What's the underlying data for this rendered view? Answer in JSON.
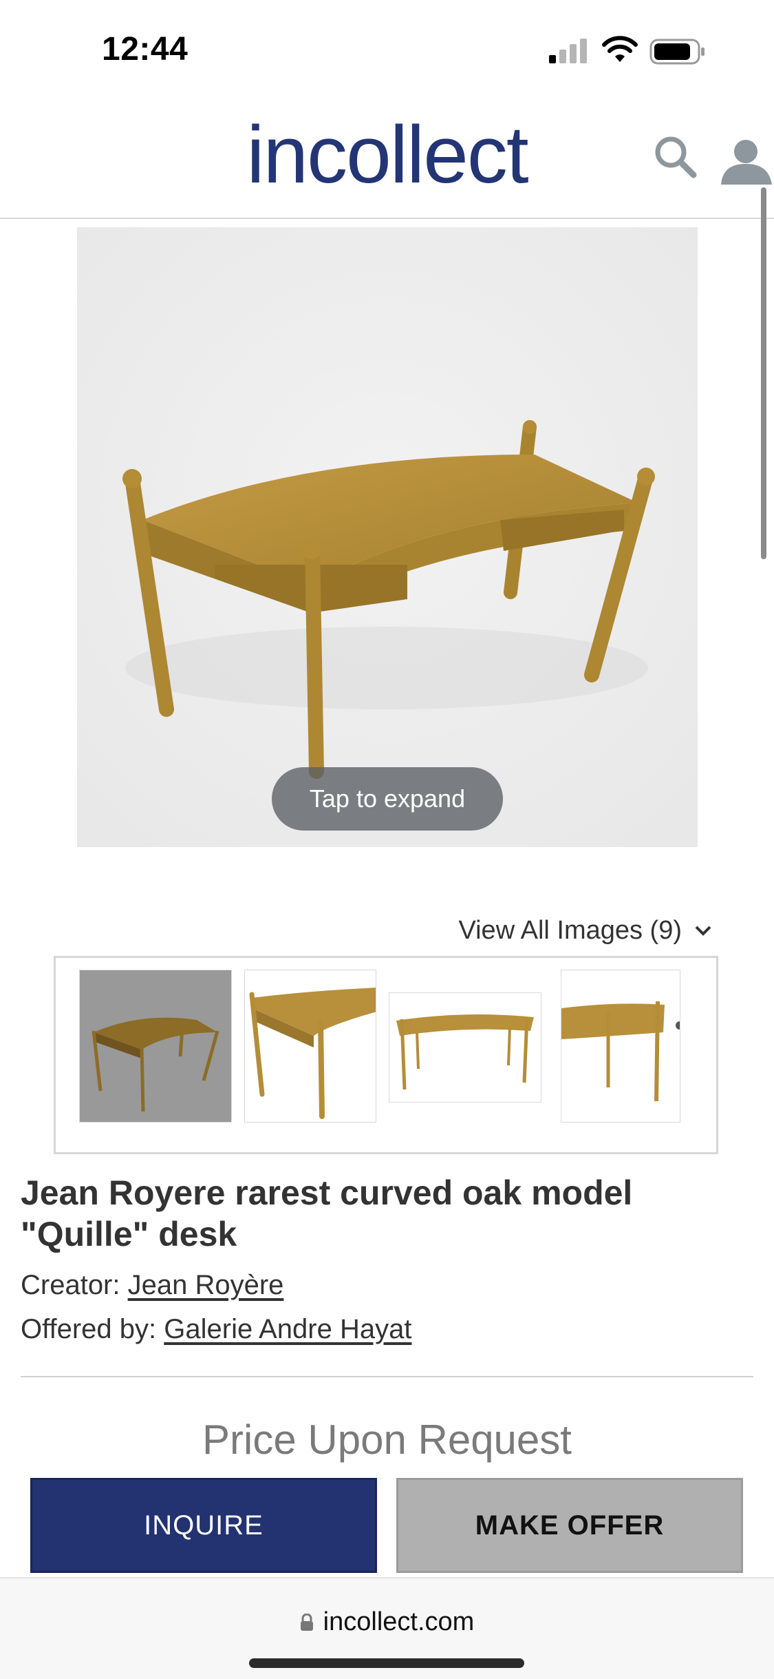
{
  "status_bar": {
    "time": "12:44"
  },
  "header": {
    "logo": "incollect",
    "icons": [
      "search-icon",
      "user-icon"
    ]
  },
  "gallery": {
    "expand_label": "Tap to expand",
    "view_all_label": "View All Images (9)",
    "thumbnail_count_visible": 4
  },
  "product": {
    "title": "Jean Royere rarest curved oak model \"Quille\" desk",
    "creator_label": "Creator: ",
    "creator_name": "Jean Royère",
    "offered_label": "Offered by: ",
    "offered_name": "Galerie Andre Hayat",
    "price": "Price Upon Request"
  },
  "actions": {
    "inquire_label": "INQUIRE",
    "offer_label": "MAKE OFFER"
  },
  "browser": {
    "url": "incollect.com"
  },
  "colors": {
    "brand_navy": "#233574",
    "offer_gray": "#b0b0b0",
    "oak": "#b08a34"
  }
}
